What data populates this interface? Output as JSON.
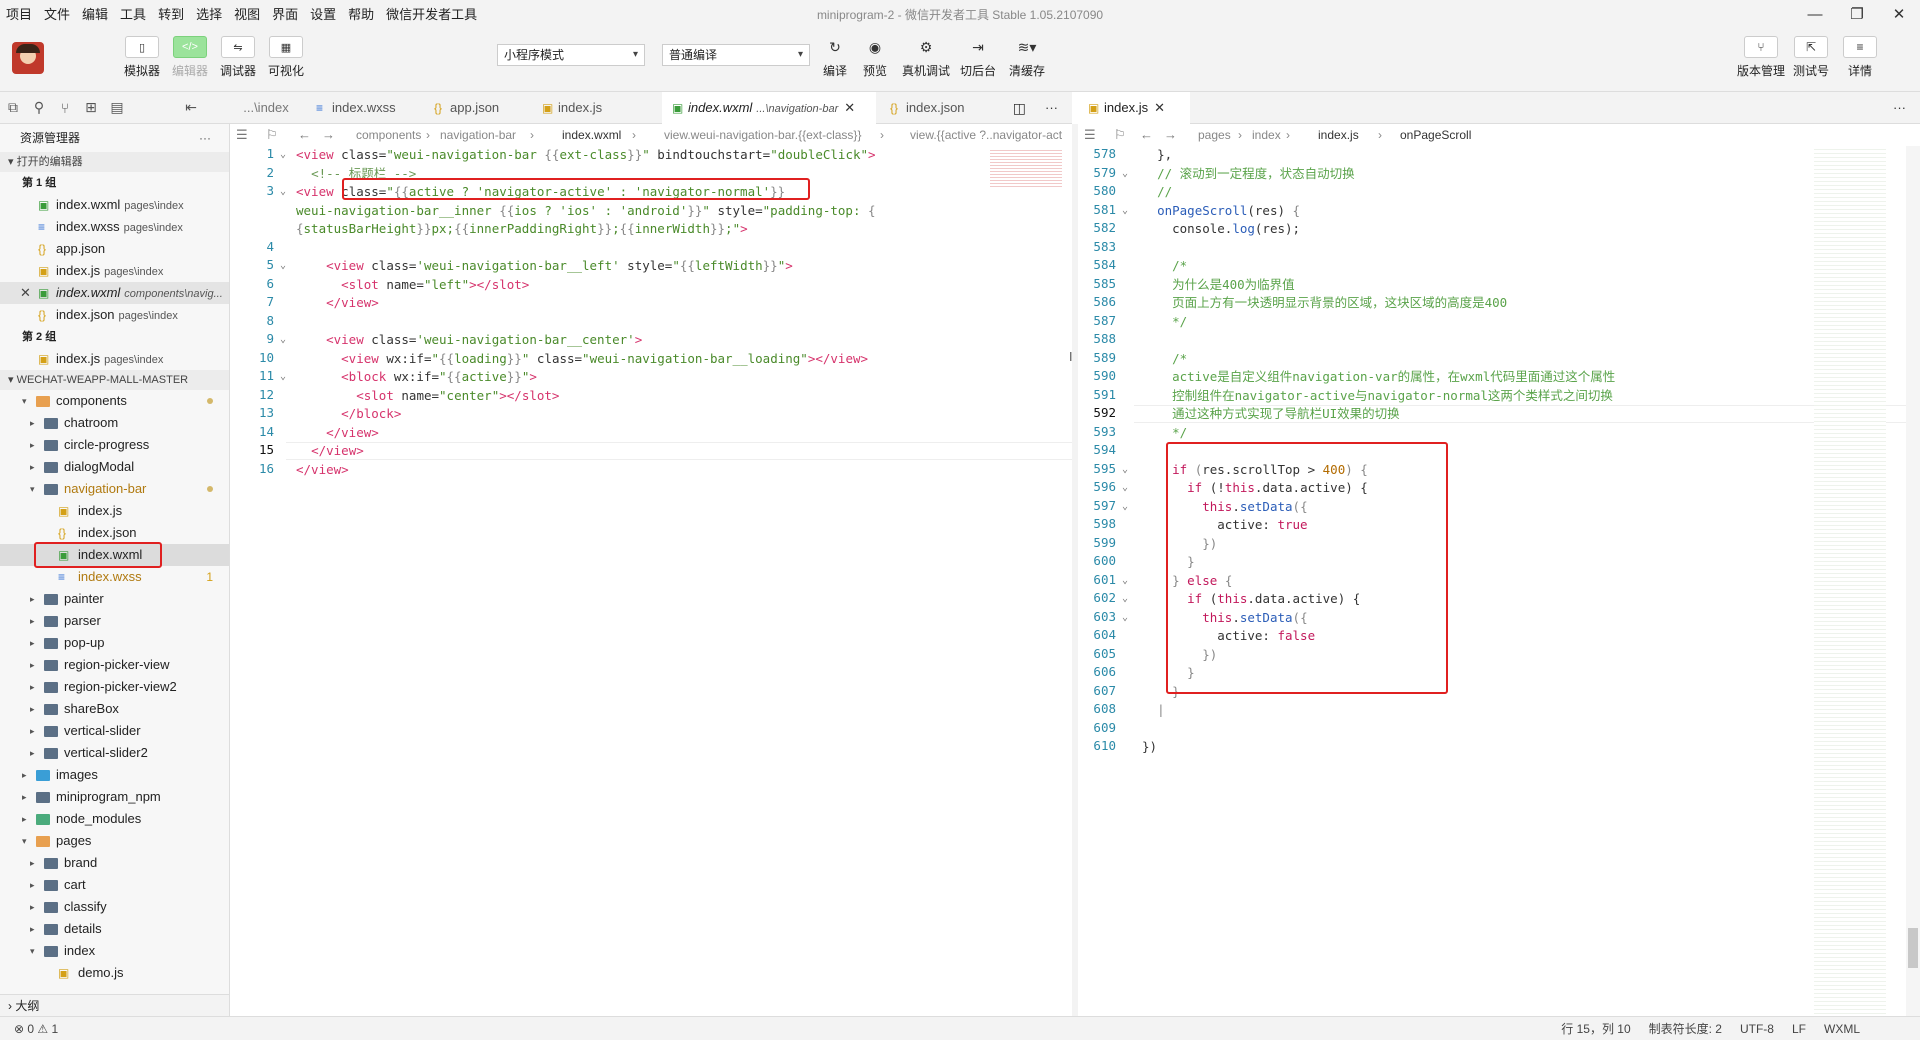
{
  "menu": {
    "items": [
      "项目",
      "文件",
      "编辑",
      "工具",
      "转到",
      "选择",
      "视图",
      "界面",
      "设置",
      "帮助",
      "微信开发者工具"
    ],
    "window_title": "miniprogram-2 - 微信开发者工具 Stable 1.05.2107090",
    "controls": {
      "minimize": "—",
      "maximize": "❐",
      "close": "✕"
    }
  },
  "toolbar": {
    "simulator": "模拟器",
    "editor": "编辑器",
    "debugger": "调试器",
    "visual": "可视化",
    "mode_select": "小程序模式",
    "compile_select": "普通编译",
    "compile": "编译",
    "preview": "预览",
    "real_debug": "真机调试",
    "cut_backend": "切后台",
    "clear_cache": "清缓存",
    "version": "版本管理",
    "test_account": "测试号",
    "details": "详情",
    "icons": {
      "simulator": "▯",
      "editor": "</>",
      "debugger": "⇋",
      "visual": "▦",
      "compile": "↻",
      "preview": "◉",
      "real_debug": "⚙",
      "cut": "⇥",
      "cache": "≋▾",
      "version": "⑂",
      "test": "⇱",
      "details": "≡"
    }
  },
  "tabs": {
    "left_truncated": "...\\index",
    "left": [
      {
        "label": "index.wxss",
        "type": "wxss"
      },
      {
        "label": "app.json",
        "type": "json"
      },
      {
        "label": "index.js",
        "type": "js"
      },
      {
        "label": "index.wxml",
        "path": "...\\navigation-bar",
        "type": "wxml",
        "active": true
      },
      {
        "label": "index.json",
        "type": "json"
      }
    ],
    "right": [
      {
        "label": "index.js",
        "type": "js",
        "active": true
      }
    ],
    "close": "✕",
    "split": "◫",
    "more": "···"
  },
  "sidebar": {
    "title": "资源管理器",
    "more": "···",
    "open_editors": "打开的编辑器",
    "group1": "第 1 组",
    "group2": "第 2 组",
    "open_files_g1": [
      {
        "name": "index.wxml",
        "path": "pages\\index",
        "type": "wxml"
      },
      {
        "name": "index.wxss",
        "path": "pages\\index",
        "type": "wxss"
      },
      {
        "name": "app.json",
        "path": "",
        "type": "json"
      },
      {
        "name": "index.js",
        "path": "pages\\index",
        "type": "js"
      },
      {
        "name": "index.wxml",
        "path": "components\\navig...",
        "type": "wxml",
        "active": true
      },
      {
        "name": "index.json",
        "path": "pages\\index",
        "type": "json"
      }
    ],
    "open_files_g2": [
      {
        "name": "index.js",
        "path": "pages\\index",
        "type": "js"
      }
    ],
    "project": "WECHAT-WEAPP-MALL-MASTER",
    "tree": [
      {
        "name": "components",
        "level": 1,
        "open": true,
        "kind": "folder-orange",
        "dot": true
      },
      {
        "name": "chatroom",
        "level": 2,
        "kind": "folder"
      },
      {
        "name": "circle-progress",
        "level": 2,
        "kind": "folder"
      },
      {
        "name": "dialogModal",
        "level": 2,
        "kind": "folder"
      },
      {
        "name": "navigation-bar",
        "level": 2,
        "open": true,
        "kind": "folder",
        "dot": true,
        "orange": true
      },
      {
        "name": "index.js",
        "level": 3,
        "kind": "js"
      },
      {
        "name": "index.json",
        "level": 3,
        "kind": "json"
      },
      {
        "name": "index.wxml",
        "level": 3,
        "kind": "wxml",
        "selected": true
      },
      {
        "name": "index.wxss",
        "level": 3,
        "kind": "wxss",
        "badge": "1"
      },
      {
        "name": "painter",
        "level": 2,
        "kind": "folder"
      },
      {
        "name": "parser",
        "level": 2,
        "kind": "folder"
      },
      {
        "name": "pop-up",
        "level": 2,
        "kind": "folder"
      },
      {
        "name": "region-picker-view",
        "level": 2,
        "kind": "folder"
      },
      {
        "name": "region-picker-view2",
        "level": 2,
        "kind": "folder"
      },
      {
        "name": "shareBox",
        "level": 2,
        "kind": "folder"
      },
      {
        "name": "vertical-slider",
        "level": 2,
        "kind": "folder"
      },
      {
        "name": "vertical-slider2",
        "level": 2,
        "kind": "folder"
      },
      {
        "name": "images",
        "level": 1,
        "kind": "folder-img"
      },
      {
        "name": "miniprogram_npm",
        "level": 1,
        "kind": "folder"
      },
      {
        "name": "node_modules",
        "level": 1,
        "kind": "folder-green"
      },
      {
        "name": "pages",
        "level": 1,
        "open": true,
        "kind": "folder-orange"
      },
      {
        "name": "brand",
        "level": 2,
        "kind": "folder"
      },
      {
        "name": "cart",
        "level": 2,
        "kind": "folder"
      },
      {
        "name": "classify",
        "level": 2,
        "kind": "folder"
      },
      {
        "name": "details",
        "level": 2,
        "kind": "folder"
      },
      {
        "name": "index",
        "level": 2,
        "open": true,
        "kind": "folder"
      },
      {
        "name": "demo.js",
        "level": 3,
        "kind": "js"
      }
    ],
    "outline": "大纲"
  },
  "left_editor": {
    "breadcrumb": [
      "components",
      "navigation-bar",
      "index.wxml",
      "view.weui-navigation-bar.{{ext-class}}",
      "view.{{active ?..navigator-act"
    ],
    "cursor": "15",
    "lines": [
      {
        "n": "1",
        "fold": true,
        "html": "<span class='t'>&lt;view</span> <span class='a'>class=</span><span class='s'>\"weui-navigation-bar </span><span class='b'>{{</span><span class='s'>ext-class</span><span class='b'>}}</span><span class='s'>\"</span> <span class='a'>bindtouchstart=</span><span class='s'>\"doubleClick\"</span><span class='t'>&gt;</span>"
      },
      {
        "n": "2",
        "html": "  <span class='c'>&lt;!-- 标题栏 --&gt;</span>"
      },
      {
        "n": "3",
        "fold": true,
        "html": "<span class='t'>&lt;view</span> <span class='a'>class=</span><span class='s'>\"</span><span class='b'>{{</span><span class='s'>active ? 'navigator-active' : 'navigator-normal'</span><span class='b'>}}</span>"
      },
      {
        "n": "",
        "html": "<span class='s'>weui-navigation-bar__inner </span><span class='b'>{{</span><span class='s'>ios ? 'ios' : 'android'</span><span class='b'>}}</span><span class='s'>\"</span> <span class='a'>style=</span><span class='s'>\"padding-top: </span><span class='b'>{</span>"
      },
      {
        "n": "",
        "html": "<span class='b'>{</span><span class='s'>statusBarHeight</span><span class='b'>}}</span><span class='s'>px;</span><span class='b'>{{</span><span class='s'>innerPaddingRight</span><span class='b'>}}</span><span class='s'>;</span><span class='b'>{{</span><span class='s'>innerWidth</span><span class='b'>}}</span><span class='s'>;\"</span><span class='t'>&gt;</span>"
      },
      {
        "n": "4",
        "html": ""
      },
      {
        "n": "5",
        "fold": true,
        "html": "    <span class='t'>&lt;view</span> <span class='a'>class=</span><span class='s'>'weui-navigation-bar__left'</span> <span class='a'>style=</span><span class='s'>\"</span><span class='b'>{{</span><span class='s'>leftWidth</span><span class='b'>}}</span><span class='s'>\"</span><span class='t'>&gt;</span>"
      },
      {
        "n": "6",
        "html": "      <span class='t'>&lt;slot</span> <span class='a'>name=</span><span class='s'>\"left\"</span><span class='t'>&gt;&lt;/slot&gt;</span>"
      },
      {
        "n": "7",
        "html": "    <span class='t'>&lt;/view&gt;</span>"
      },
      {
        "n": "8",
        "html": ""
      },
      {
        "n": "9",
        "fold": true,
        "html": "    <span class='t'>&lt;view</span> <span class='a'>class=</span><span class='s'>'weui-navigation-bar__center'</span><span class='t'>&gt;</span>"
      },
      {
        "n": "10",
        "html": "      <span class='t'>&lt;view</span> <span class='a'>wx:if=</span><span class='s'>\"</span><span class='b'>{{</span><span class='s'>loading</span><span class='b'>}}</span><span class='s'>\"</span> <span class='a'>class=</span><span class='s'>\"weui-navigation-bar__loading\"</span><span class='t'>&gt;&lt;/view&gt;</span>"
      },
      {
        "n": "11",
        "fold": true,
        "html": "      <span class='t'>&lt;block</span> <span class='a'>wx:if=</span><span class='s'>\"</span><span class='b'>{{</span><span class='s'>active</span><span class='b'>}}</span><span class='s'>\"</span><span class='t'>&gt;</span>"
      },
      {
        "n": "12",
        "html": "        <span class='t'>&lt;slot</span> <span class='a'>name=</span><span class='s'>\"center\"</span><span class='t'>&gt;&lt;/slot&gt;</span>"
      },
      {
        "n": "13",
        "html": "      <span class='t'>&lt;/block&gt;</span>"
      },
      {
        "n": "14",
        "html": "    <span class='t'>&lt;/view&gt;</span>"
      },
      {
        "n": "15",
        "cur": true,
        "html": "  <span class='t'>&lt;/view&gt;</span>"
      },
      {
        "n": "16",
        "html": "<span class='t'>&lt;/view&gt;</span>"
      }
    ]
  },
  "right_editor": {
    "breadcrumb": [
      "pages",
      "index",
      "index.js",
      "onPageScroll"
    ],
    "lines": [
      {
        "n": "578",
        "html": "  <span class='p'>},</span>"
      },
      {
        "n": "579",
        "fold": true,
        "html": "  <span class='cm'>// 滚动到一定程度，状态自动切换</span>"
      },
      {
        "n": "580",
        "html": "  <span class='cm'>//</span>"
      },
      {
        "n": "581",
        "fold": true,
        "html": "  <span class='ident'>onPageScroll</span><span class='p'>(res) </span><span class='b'>{</span>"
      },
      {
        "n": "582",
        "html": "    <span class='p'>console.</span><span class='ident'>log</span><span class='p'>(res);</span>"
      },
      {
        "n": "583",
        "html": ""
      },
      {
        "n": "584",
        "html": "    <span class='cm'>/*</span>"
      },
      {
        "n": "585",
        "html": "    <span class='cm'>为什么是400为临界值</span>"
      },
      {
        "n": "586",
        "html": "    <span class='cm'>页面上方有一块透明显示背景的区域，这块区域的高度是400</span>"
      },
      {
        "n": "587",
        "html": "    <span class='cm'>*/</span>"
      },
      {
        "n": "588",
        "html": ""
      },
      {
        "n": "589",
        "html": "    <span class='cm'>/*</span>"
      },
      {
        "n": "590",
        "html": "    <span class='cm'>active是自定义组件navigation-var的属性，在wxml代码里面通过这个属性</span>"
      },
      {
        "n": "591",
        "html": "    <span class='cm'>控制组件在navigator-active与navigator-normal这两个类样式之间切换</span>"
      },
      {
        "n": "592",
        "cur": true,
        "html": "    <span class='cm'>通过这种方式实现了导航栏UI效果的切换</span>"
      },
      {
        "n": "593",
        "html": "    <span class='cm'>*/</span>"
      },
      {
        "n": "594",
        "html": ""
      },
      {
        "n": "595",
        "fold": true,
        "html": "    <span class='k'>if</span> <span class='b'>(</span><span class='p'>res.scrollTop &gt; </span><span class='num2'>400</span><span class='b'>) {</span>"
      },
      {
        "n": "596",
        "fold": true,
        "html": "      <span class='k'>if</span> <span class='p'>(!</span><span class='k'>this</span><span class='p'>.data.active) {</span>"
      },
      {
        "n": "597",
        "fold": true,
        "html": "        <span class='k'>this</span><span class='p'>.</span><span class='ident'>setData</span><span class='b'>({</span>"
      },
      {
        "n": "598",
        "html": "          <span class='p'>active: </span><span class='k'>true</span>"
      },
      {
        "n": "599",
        "html": "        <span class='b'>})</span>"
      },
      {
        "n": "600",
        "html": "      <span class='b'>}</span>"
      },
      {
        "n": "601",
        "fold": true,
        "html": "    <span class='b'>}</span> <span class='k'>else</span> <span class='b'>{</span>"
      },
      {
        "n": "602",
        "fold": true,
        "html": "      <span class='k'>if</span> <span class='p'>(</span><span class='k'>this</span><span class='p'>.data.active) {</span>"
      },
      {
        "n": "603",
        "fold": true,
        "html": "        <span class='k'>this</span><span class='p'>.</span><span class='ident'>setData</span><span class='b'>({</span>"
      },
      {
        "n": "604",
        "html": "          <span class='p'>active: </span><span class='k'>false</span>"
      },
      {
        "n": "605",
        "html": "        <span class='b'>})</span>"
      },
      {
        "n": "606",
        "html": "      <span class='b'>}</span>"
      },
      {
        "n": "607",
        "html": "    <span class='b'>}</span>"
      },
      {
        "n": "608",
        "html": "  <span class='b'>|</span>"
      },
      {
        "n": "609",
        "html": ""
      },
      {
        "n": "610",
        "html": "<span class='p'>})</span>"
      }
    ]
  },
  "status": {
    "problems": "⊗ 0 ⚠ 1",
    "position": "行 15，列 10",
    "indent": "制表符长度: 2",
    "encoding": "UTF-8",
    "eol": "LF",
    "lang": "WXML"
  }
}
